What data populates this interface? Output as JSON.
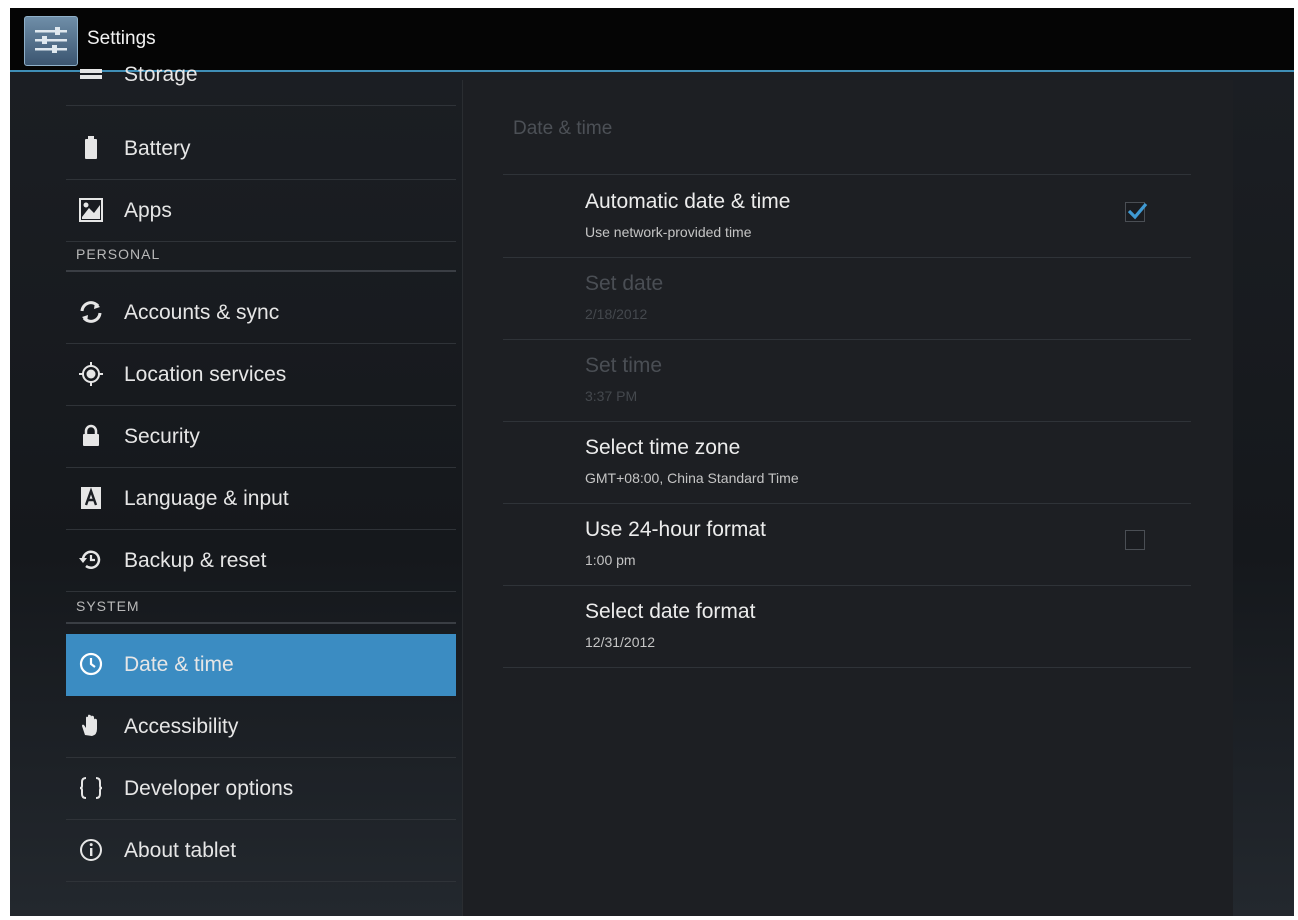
{
  "app": {
    "title": "Settings",
    "icon": "settings-sliders-icon"
  },
  "sidebar": {
    "items": [
      {
        "label": "Storage",
        "icon": "storage-icon"
      },
      {
        "label": "Battery",
        "icon": "battery-icon"
      },
      {
        "label": "Apps",
        "icon": "apps-icon"
      }
    ],
    "personal_header": "PERSONAL",
    "personal_items": [
      {
        "label": "Accounts & sync",
        "icon": "sync-icon"
      },
      {
        "label": "Location services",
        "icon": "location-icon"
      },
      {
        "label": "Security",
        "icon": "lock-icon"
      },
      {
        "label": "Language & input",
        "icon": "language-icon"
      },
      {
        "label": "Backup & reset",
        "icon": "backup-icon"
      }
    ],
    "system_header": "SYSTEM",
    "system_items": [
      {
        "label": "Date & time",
        "icon": "clock-icon",
        "selected": true
      },
      {
        "label": "Accessibility",
        "icon": "hand-icon"
      },
      {
        "label": "Developer options",
        "icon": "braces-icon"
      },
      {
        "label": "About tablet",
        "icon": "info-icon"
      }
    ]
  },
  "detail": {
    "title": "Date & time",
    "prefs": [
      {
        "title": "Automatic date & time",
        "summary": "Use network-provided time",
        "checkbox": true,
        "checked": true,
        "enabled": true
      },
      {
        "title": "Set date",
        "summary": "2/18/2012",
        "enabled": false
      },
      {
        "title": "Set time",
        "summary": "3:37 PM",
        "enabled": false
      },
      {
        "title": "Select time zone",
        "summary": "GMT+08:00, China Standard Time",
        "enabled": true
      },
      {
        "title": "Use 24-hour format",
        "summary": "1:00 pm",
        "checkbox": true,
        "checked": false,
        "enabled": true
      },
      {
        "title": "Select date format",
        "summary": "12/31/2012",
        "enabled": true
      }
    ]
  },
  "colors": {
    "accent": "#3b8cc2",
    "actionbar_rule": "#3f8eb6"
  }
}
